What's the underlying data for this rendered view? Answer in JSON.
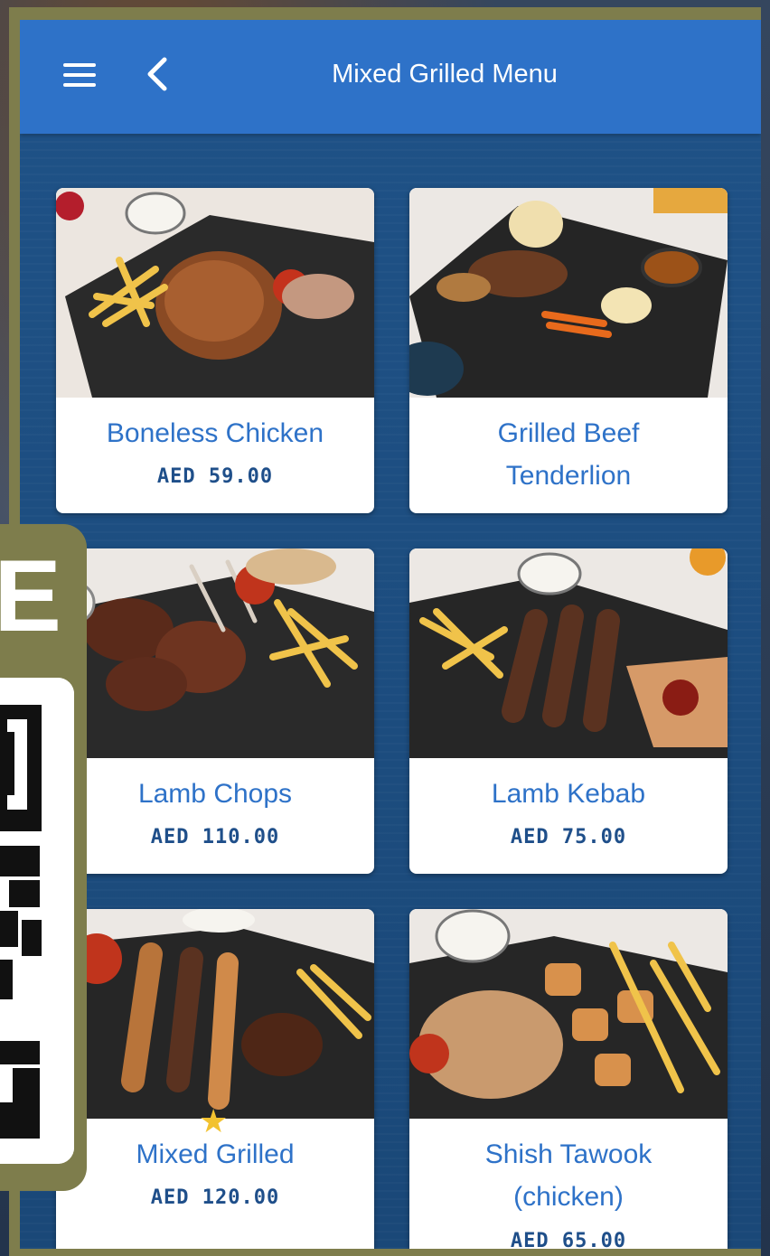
{
  "header": {
    "title": "Mixed Grilled Menu"
  },
  "icons": {
    "menu": "hamburger-menu-icon",
    "back": "chevron-left-icon",
    "favorite": "star-icon"
  },
  "menu_items": [
    {
      "name": "Boneless Chicken",
      "price": "AED 59.00"
    },
    {
      "name": "Grilled Beef Tenderlion",
      "name_line1": "Grilled Beef",
      "name_line2": "Tenderlion",
      "price": ""
    },
    {
      "name": "Lamb Chops",
      "price": "AED 110.00"
    },
    {
      "name": "Lamb Kebab",
      "price": "AED 75.00"
    },
    {
      "name": "Mixed Grilled",
      "price": "AED 120.00"
    },
    {
      "name": "Shish Tawook (chicken)",
      "name_line1": "Shish Tawook",
      "name_line2": "(chicken)",
      "price": "AED 65.00"
    }
  ],
  "promo_overlay": {
    "text_fragment": "RE"
  },
  "colors": {
    "appbar": "#2e72c8",
    "background": "#1c4c80",
    "frame": "#7e7d4c",
    "item_name": "#2e72c8",
    "price": "#1f4f8a",
    "star": "#f2c230"
  }
}
